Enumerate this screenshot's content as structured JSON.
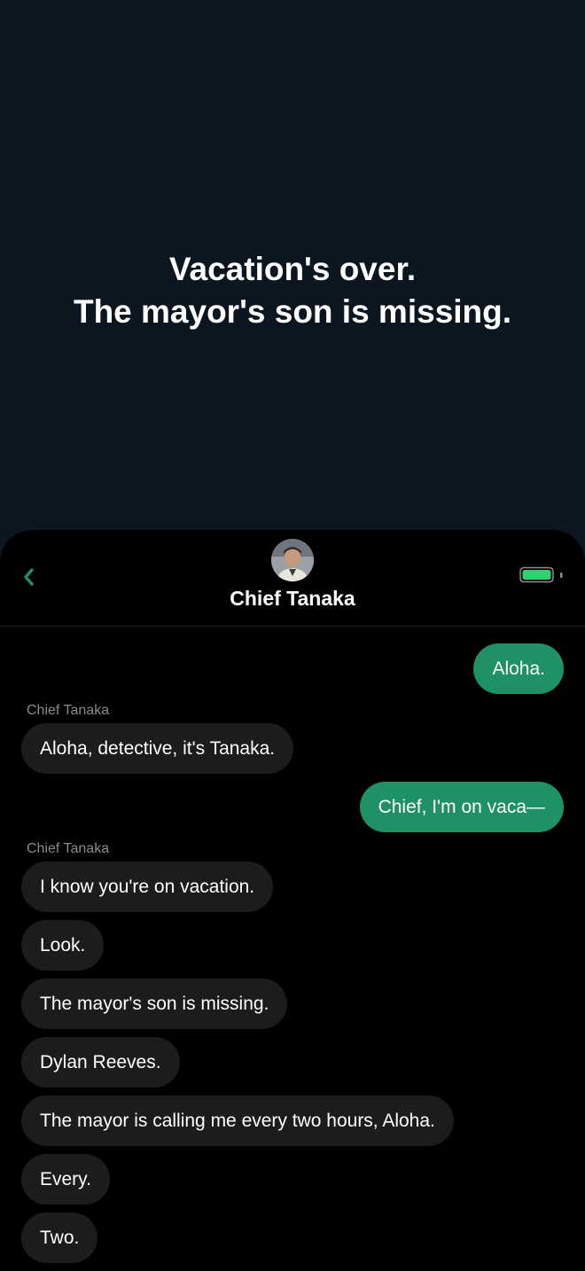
{
  "headline": {
    "line1": "Vacation's over.",
    "line2": "The mayor's son is missing."
  },
  "chat": {
    "contact_name": "Chief Tanaka",
    "back_icon": "chevron-left-icon",
    "battery_icon": "battery-icon",
    "accent_color": "#1e9264",
    "messages": [
      {
        "from": "me",
        "text": "Aloha."
      },
      {
        "from": "them",
        "sender": "Chief Tanaka",
        "text": "Aloha, detective, it's Tanaka."
      },
      {
        "from": "me",
        "text": "Chief, I'm on vaca—"
      },
      {
        "from": "them",
        "sender": "Chief Tanaka",
        "text": "I know you're on vacation."
      },
      {
        "from": "them",
        "text": "Look."
      },
      {
        "from": "them",
        "text": "The mayor's son is missing."
      },
      {
        "from": "them",
        "text": "Dylan Reeves."
      },
      {
        "from": "them",
        "text": "The mayor is calling me every two hours, Aloha."
      },
      {
        "from": "them",
        "text": "Every."
      },
      {
        "from": "them",
        "text": "Two."
      }
    ]
  }
}
